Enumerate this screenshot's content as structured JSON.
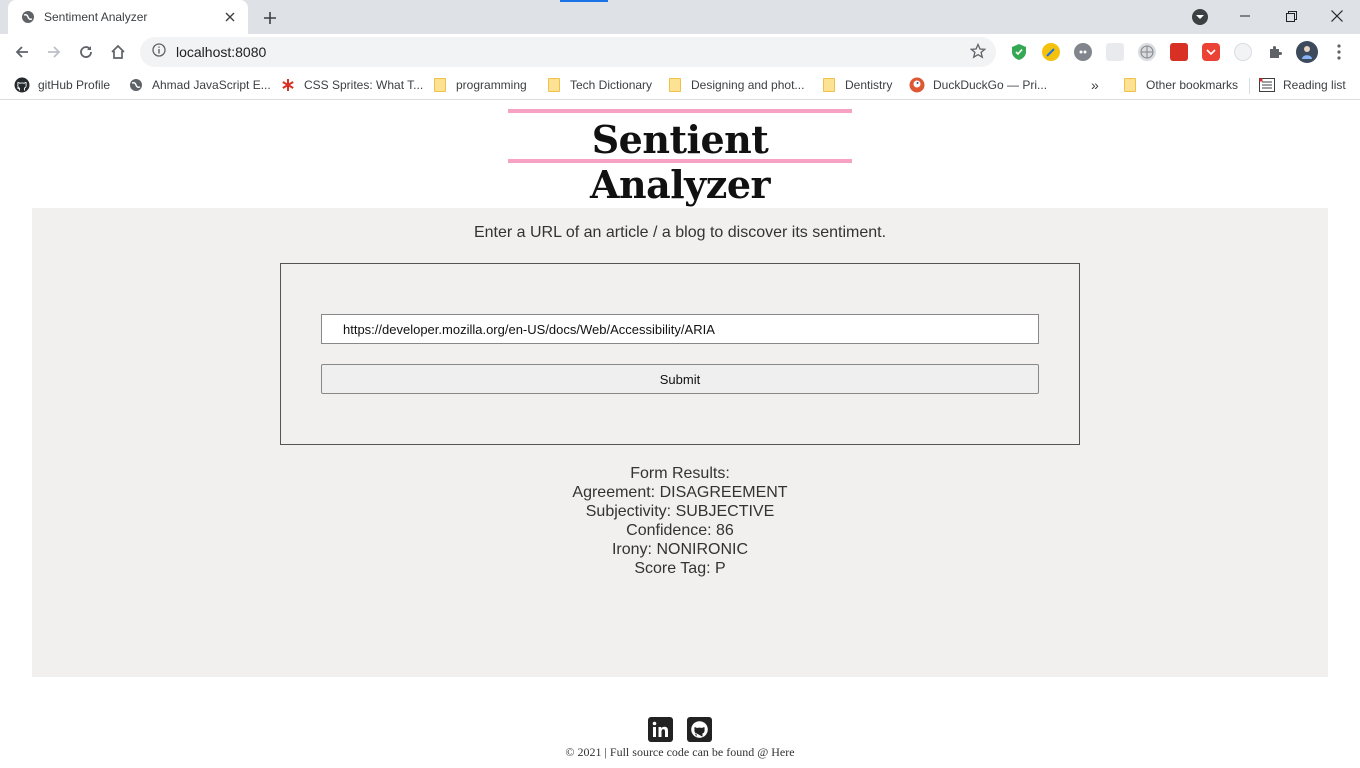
{
  "browser": {
    "tab_title": "Sentiment Analyzer",
    "url": "localhost:8080",
    "bookmarks": [
      {
        "label": "gitHub Profile",
        "icon": "github-icon"
      },
      {
        "label": "Ahmad JavaScript E...",
        "icon": "globe-icon"
      },
      {
        "label": "CSS Sprites: What T...",
        "icon": "asterisk-icon"
      },
      {
        "label": "programming",
        "icon": "folder-icon"
      },
      {
        "label": "Tech Dictionary",
        "icon": "folder-icon"
      },
      {
        "label": "Designing and phot...",
        "icon": "folder-icon"
      },
      {
        "label": "Dentistry",
        "icon": "folder-icon"
      },
      {
        "label": "DuckDuckGo — Pri...",
        "icon": "duckduckgo-icon"
      }
    ],
    "overflow_label": "»",
    "other_bookmarks": "Other bookmarks",
    "reading_list": "Reading list"
  },
  "page": {
    "title": "Sentient Analyzer",
    "instruction": "Enter a URL of an article / a blog to discover its sentiment.",
    "url_input_value": "https://developer.mozilla.org/en-US/docs/Web/Accessibility/ARIA",
    "submit_label": "Submit",
    "results": {
      "heading": "Form Results:",
      "agreement": "Agreement: DISAGREEMENT",
      "subjectivity": "Subjectivity: SUBJECTIVE",
      "confidence": "Confidence: 86",
      "irony": "Irony: NONIRONIC",
      "score_tag": "Score Tag: P"
    },
    "footer_text": "© 2021 | Full source code can be found @ Here"
  },
  "colors": {
    "title_accent": "#f7a1c4",
    "panel_bg": "#f1f0ee"
  }
}
